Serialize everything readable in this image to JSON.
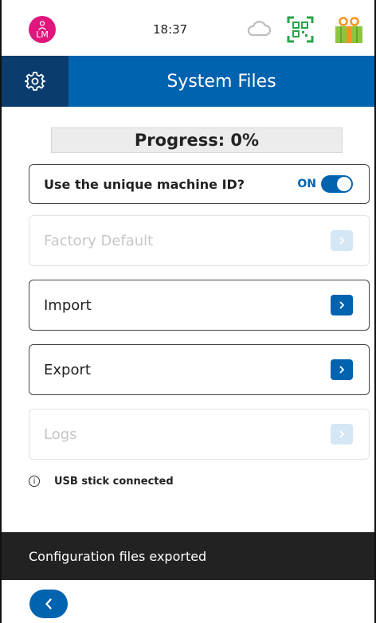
{
  "status": {
    "avatar_initials": "LM",
    "time": "18:37",
    "icons": [
      "user-icon",
      "cloud-sync-icon",
      "qr-code-icon",
      "gift-icon"
    ]
  },
  "header": {
    "title": "System Files",
    "settings_icon": "gear-icon"
  },
  "progress": {
    "label": "Progress: 0%",
    "value": 0
  },
  "machine_id": {
    "label": "Use the unique machine ID?",
    "state": "ON",
    "enabled": true
  },
  "menu": [
    {
      "label": "Factory Default",
      "enabled": false
    },
    {
      "label": "Import",
      "enabled": true
    },
    {
      "label": "Export",
      "enabled": true
    },
    {
      "label": "Logs",
      "enabled": false
    }
  ],
  "usb_status": "USB stick connected",
  "toast": "Configuration files exported",
  "colors": {
    "primary": "#0063b0",
    "header_dark": "#0b3c6e",
    "avatar": "#e0167c",
    "qr_green": "#2aa44a",
    "gift_green": "#8cc63f",
    "gift_orange": "#f7941d",
    "toast_bg": "#222222"
  }
}
